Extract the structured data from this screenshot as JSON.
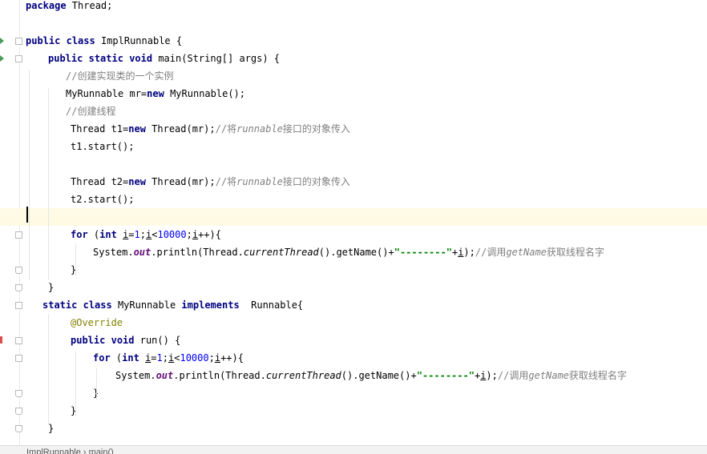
{
  "editor": {
    "lines": [
      {
        "parts": [
          {
            "t": "package",
            "c": "kw"
          },
          {
            "t": " Thread;"
          }
        ]
      },
      {
        "parts": []
      },
      {
        "parts": [
          {
            "t": "public",
            "c": "kw"
          },
          {
            "t": " "
          },
          {
            "t": "class",
            "c": "kw"
          },
          {
            "t": " ImplRunnable {"
          }
        ]
      },
      {
        "parts": [
          {
            "t": "public",
            "c": "kw"
          },
          {
            "t": " "
          },
          {
            "t": "static",
            "c": "kw"
          },
          {
            "t": " "
          },
          {
            "t": "void",
            "c": "kw"
          },
          {
            "t": " main(String[] args) {"
          }
        ]
      },
      {
        "parts": [
          {
            "t": "//创建实现类的一个实例",
            "c": "cm"
          }
        ]
      },
      {
        "parts": [
          {
            "t": "MyRunnable mr="
          },
          {
            "t": "new",
            "c": "kw"
          },
          {
            "t": " MyRunnable();"
          }
        ]
      },
      {
        "parts": [
          {
            "t": "//创建线程",
            "c": "cm"
          }
        ]
      },
      {
        "parts": [
          {
            "t": "Thread t1="
          },
          {
            "t": "new",
            "c": "kw"
          },
          {
            "t": " Thread(mr);"
          },
          {
            "t": "//将",
            "c": "cm"
          },
          {
            "t": "runnable",
            "c": "cm it"
          },
          {
            "t": "接口的对象传入",
            "c": "cm"
          }
        ]
      },
      {
        "parts": [
          {
            "t": "t1.start();"
          }
        ]
      },
      {
        "parts": []
      },
      {
        "parts": [
          {
            "t": "Thread t2="
          },
          {
            "t": "new",
            "c": "kw"
          },
          {
            "t": " Thread(mr);"
          },
          {
            "t": "//将",
            "c": "cm"
          },
          {
            "t": "runnable",
            "c": "cm it"
          },
          {
            "t": "接口的对象传入",
            "c": "cm"
          }
        ]
      },
      {
        "parts": [
          {
            "t": "t2.start();"
          }
        ]
      },
      {
        "parts": []
      },
      {
        "parts": [
          {
            "t": "for",
            "c": "kw"
          },
          {
            "t": " ("
          },
          {
            "t": "int",
            "c": "kw"
          },
          {
            "t": " "
          },
          {
            "t": "i",
            "c": "ul"
          },
          {
            "t": "="
          },
          {
            "t": "1",
            "c": "num"
          },
          {
            "t": ";"
          },
          {
            "t": "i",
            "c": "ul"
          },
          {
            "t": "<"
          },
          {
            "t": "10000",
            "c": "num"
          },
          {
            "t": ";"
          },
          {
            "t": "i",
            "c": "ul"
          },
          {
            "t": "++){"
          }
        ]
      },
      {
        "parts": [
          {
            "t": "System."
          },
          {
            "t": "out",
            "c": "fld"
          },
          {
            "t": ".println(Thread."
          },
          {
            "t": "currentThread",
            "c": "it"
          },
          {
            "t": "().getName()+"
          },
          {
            "t": "\"--------\"",
            "c": "str"
          },
          {
            "t": "+"
          },
          {
            "t": "i",
            "c": "ul"
          },
          {
            "t": ");"
          },
          {
            "t": "//调用",
            "c": "cm"
          },
          {
            "t": "getName",
            "c": "cm it"
          },
          {
            "t": "获取线程名字",
            "c": "cm"
          }
        ]
      },
      {
        "parts": [
          {
            "t": "}"
          }
        ]
      },
      {
        "parts": [
          {
            "t": "}"
          }
        ]
      },
      {
        "parts": [
          {
            "t": "static",
            "c": "kw"
          },
          {
            "t": " "
          },
          {
            "t": "class",
            "c": "kw"
          },
          {
            "t": " MyRunnable "
          },
          {
            "t": "implements",
            "c": "kw"
          },
          {
            "t": "  Runnable{"
          }
        ]
      },
      {
        "parts": [
          {
            "t": "@Override",
            "c": "ann"
          }
        ]
      },
      {
        "parts": [
          {
            "t": "public",
            "c": "kw"
          },
          {
            "t": " "
          },
          {
            "t": "void",
            "c": "kw"
          },
          {
            "t": " run() {"
          }
        ]
      },
      {
        "parts": [
          {
            "t": "for",
            "c": "kw"
          },
          {
            "t": " ("
          },
          {
            "t": "int",
            "c": "kw"
          },
          {
            "t": " "
          },
          {
            "t": "i",
            "c": "ul"
          },
          {
            "t": "="
          },
          {
            "t": "1",
            "c": "num"
          },
          {
            "t": ";"
          },
          {
            "t": "i",
            "c": "ul"
          },
          {
            "t": "<"
          },
          {
            "t": "10000",
            "c": "num"
          },
          {
            "t": ";"
          },
          {
            "t": "i",
            "c": "ul"
          },
          {
            "t": "++){"
          }
        ]
      },
      {
        "parts": [
          {
            "t": "System."
          },
          {
            "t": "out",
            "c": "fld"
          },
          {
            "t": ".println(Thread."
          },
          {
            "t": "currentThread",
            "c": "it"
          },
          {
            "t": "().getName()+"
          },
          {
            "t": "\"--------\"",
            "c": "str"
          },
          {
            "t": "+"
          },
          {
            "t": "i",
            "c": "ul"
          },
          {
            "t": ");"
          },
          {
            "t": "//调用",
            "c": "cm"
          },
          {
            "t": "getName",
            "c": "cm it"
          },
          {
            "t": "获取线程名字",
            "c": "cm"
          }
        ]
      },
      {
        "parts": [
          {
            "t": "}"
          }
        ]
      },
      {
        "parts": [
          {
            "t": "}"
          }
        ]
      },
      {
        "parts": [
          {
            "t": "}"
          }
        ]
      }
    ]
  },
  "statusbar": {
    "breadcrumb": "ImplRunnable › main()"
  },
  "colors": {
    "keyword": "#000080",
    "comment": "#808080",
    "number": "#0000ff",
    "string": "#008000",
    "annotation": "#808000",
    "field": "#660e7a",
    "caret_line": "#fffae3"
  },
  "icons": {
    "run_gutter": "run-arrow-icon",
    "implements_gutter": "implemented-method-icon",
    "fold": "fold-marker-icon"
  }
}
